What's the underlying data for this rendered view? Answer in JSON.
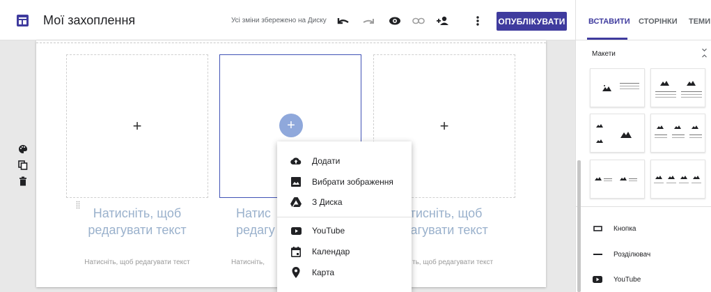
{
  "app": {
    "title": "Мої захоплення",
    "save_status": "Усі зміни збережено на Диску",
    "publish_label": "ОПУБЛІКУВАТИ",
    "accent_color": "#3f3b9e",
    "toolbar_icons": [
      "undo-icon",
      "redo-icon",
      "preview-icon",
      "link-icon",
      "add-person-icon",
      "more-vert-icon"
    ]
  },
  "canvas": {
    "cards": [
      {
        "title": "Натисніть, щоб редагувати текст",
        "subtitle": "Натисніть, щоб редагувати текст"
      },
      {
        "title": "Натисніть, щоб редагувати текст",
        "subtitle": "Натисніть, щоб редагувати текст"
      },
      {
        "title": "Натисніть, щоб редагувати текст",
        "subtitle": "Натисніть, щоб редагувати текст"
      }
    ],
    "visible_fragments": {
      "middle_title": "Натис\nредагу",
      "middle_sub": "Натисніть,",
      "right_title": "атисніть, щоб\nдагувати текст",
      "right_sub": "ть, щоб редагувати текст"
    },
    "side_tools": [
      "palette-icon",
      "duplicate-icon",
      "delete-icon"
    ]
  },
  "insert_menu": {
    "items": [
      {
        "label": "Додати",
        "icon": "cloud-upload-icon"
      },
      {
        "label": "Вибрати зображення",
        "icon": "image-icon"
      },
      {
        "label": "З Диска",
        "icon": "drive-icon"
      },
      {
        "label": "YouTube",
        "icon": "youtube-icon"
      },
      {
        "label": "Календар",
        "icon": "calendar-icon"
      },
      {
        "label": "Карта",
        "icon": "map-pin-icon"
      }
    ]
  },
  "right_panel": {
    "tabs": [
      "ВСТАВИТИ",
      "СТОРІНКИ",
      "ТЕМИ"
    ],
    "active_tab": "ВСТАВИТИ",
    "layouts_title": "Макети",
    "content_items": [
      {
        "label": "Кнопка",
        "icon": "button-icon"
      },
      {
        "label": "Розділювач",
        "icon": "divider-icon"
      },
      {
        "label": "YouTube",
        "icon": "youtube-icon"
      }
    ]
  }
}
